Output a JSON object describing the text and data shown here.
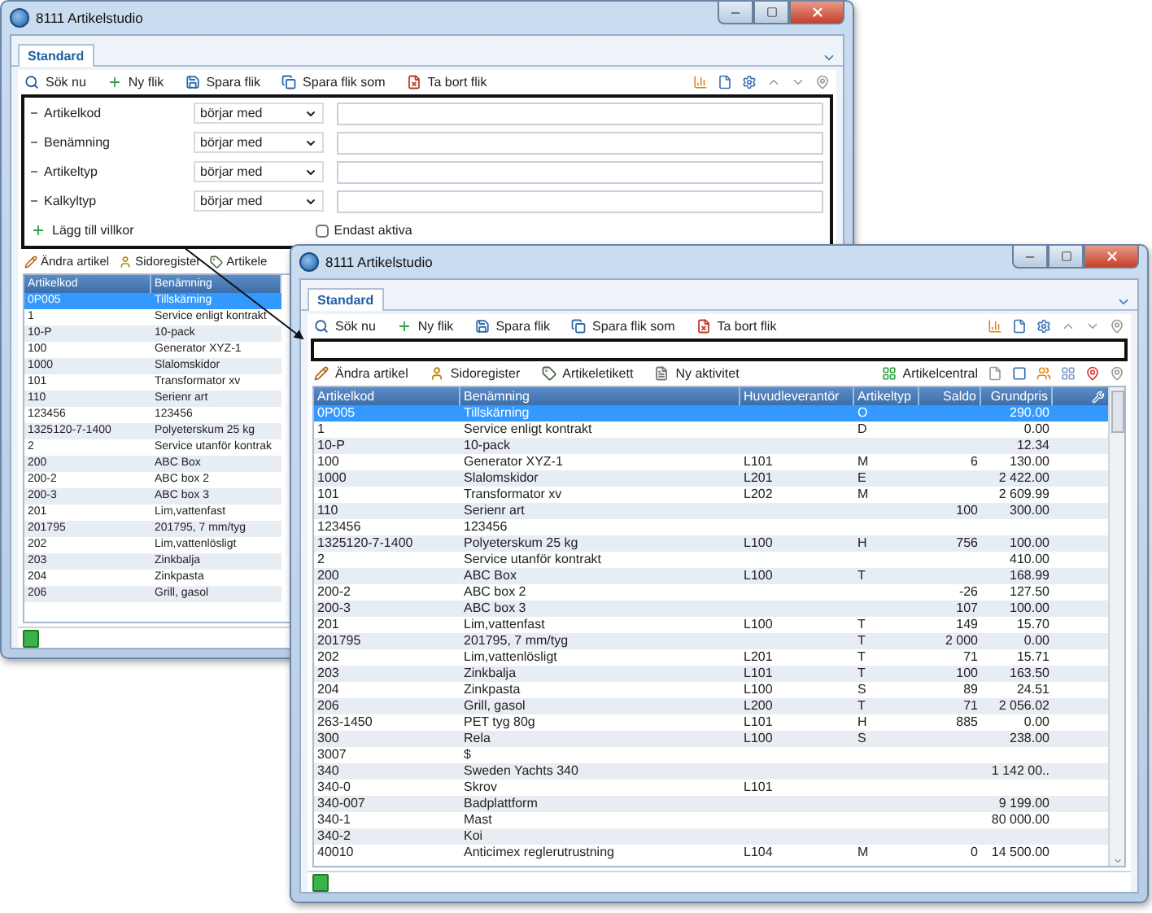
{
  "windows": [
    {
      "title": "8111 Artikelstudio",
      "tabs": [
        {
          "label": "Standard",
          "selected": true
        }
      ],
      "toolbar": [
        {
          "kind": "search",
          "label": "Sök nu"
        },
        {
          "kind": "add",
          "label": "Ny flik"
        },
        {
          "kind": "save",
          "label": "Spara flik"
        },
        {
          "kind": "save_as",
          "label": "Spara flik som"
        },
        {
          "kind": "delete",
          "label": "Ta bort flik"
        }
      ],
      "filter": {
        "conditions": [
          {
            "field": "Artikelkod",
            "operator": "börjar med"
          },
          {
            "field": "Benämning",
            "operator": "börjar med"
          },
          {
            "field": "Artikeltyp",
            "operator": "börjar med"
          },
          {
            "field": "Kalkyltyp",
            "operator": "börjar med"
          }
        ],
        "add_label": "Lägg till villkor",
        "only_active": {
          "label": "Endast aktiva",
          "checked": false
        }
      },
      "actions": [
        {
          "kind": "edit",
          "label": "Ändra artikel"
        },
        {
          "kind": "register",
          "label": "Sidoregister"
        },
        {
          "kind": "label",
          "label": "Artikele"
        }
      ],
      "table": {
        "columns": [
          {
            "label": "Artikelkod",
            "numeric": false
          },
          {
            "label": "Benämning",
            "numeric": false
          }
        ],
        "rows": [
          {
            "cells": [
              "0P005",
              "Tillskärning"
            ],
            "selected": true
          },
          {
            "cells": [
              "1",
              "Service enligt kontrakt"
            ],
            "selected": false
          },
          {
            "cells": [
              "10-P",
              "10-pack"
            ],
            "selected": false
          },
          {
            "cells": [
              "100",
              "Generator XYZ-1"
            ],
            "selected": false
          },
          {
            "cells": [
              "1000",
              "Slalomskidor"
            ],
            "selected": false
          },
          {
            "cells": [
              "101",
              "Transformator xv"
            ],
            "selected": false
          },
          {
            "cells": [
              "110",
              "Serienr art"
            ],
            "selected": false
          },
          {
            "cells": [
              "123456",
              "123456"
            ],
            "selected": false
          },
          {
            "cells": [
              "1325120-7-1400",
              "Polyeterskum 25 kg"
            ],
            "selected": false
          },
          {
            "cells": [
              "2",
              "Service utanför kontrak"
            ],
            "selected": false
          },
          {
            "cells": [
              "200",
              "ABC Box"
            ],
            "selected": false
          },
          {
            "cells": [
              "200-2",
              "ABC box 2"
            ],
            "selected": false
          },
          {
            "cells": [
              "200-3",
              "ABC box 3"
            ],
            "selected": false
          },
          {
            "cells": [
              "201",
              "Lim,vattenfast"
            ],
            "selected": false
          },
          {
            "cells": [
              "201795",
              "201795, 7 mm/tyg"
            ],
            "selected": false
          },
          {
            "cells": [
              "202",
              "Lim,vattenlösligt"
            ],
            "selected": false
          },
          {
            "cells": [
              "203",
              "Zinkbalja"
            ],
            "selected": false
          },
          {
            "cells": [
              "204",
              "Zinkpasta"
            ],
            "selected": false
          },
          {
            "cells": [
              "206",
              "Grill, gasol"
            ],
            "selected": false
          }
        ]
      }
    },
    {
      "title": "8111 Artikelstudio",
      "tabs": [
        {
          "label": "Standard",
          "selected": true
        }
      ],
      "toolbar": [
        {
          "kind": "search",
          "label": "Sök nu"
        },
        {
          "kind": "add",
          "label": "Ny flik"
        },
        {
          "kind": "save",
          "label": "Spara flik"
        },
        {
          "kind": "save_as",
          "label": "Spara flik som"
        },
        {
          "kind": "delete",
          "label": "Ta bort flik"
        }
      ],
      "actions": [
        {
          "kind": "edit",
          "label": "Ändra artikel"
        },
        {
          "kind": "register",
          "label": "Sidoregister"
        },
        {
          "kind": "label",
          "label": "Artikeletikett"
        },
        {
          "kind": "activity",
          "label": "Ny aktivitet"
        }
      ],
      "central": {
        "label": "Artikelcentral"
      },
      "table": {
        "columns": [
          {
            "label": "Artikelkod",
            "numeric": false
          },
          {
            "label": "Benämning",
            "numeric": false
          },
          {
            "label": "Huvudleverantör",
            "numeric": false
          },
          {
            "label": "Artikeltyp",
            "numeric": false
          },
          {
            "label": "Saldo",
            "numeric": true
          },
          {
            "label": "Grundpris",
            "numeric": true
          }
        ],
        "rows": [
          {
            "cells": [
              "0P005",
              "Tillskärning",
              null,
              "O",
              null,
              "290.00"
            ],
            "selected": true
          },
          {
            "cells": [
              "1",
              "Service enligt kontrakt",
              null,
              "D",
              null,
              "0.00"
            ],
            "selected": false
          },
          {
            "cells": [
              "10-P",
              "10-pack",
              null,
              null,
              null,
              "12.34"
            ],
            "selected": false
          },
          {
            "cells": [
              "100",
              "Generator XYZ-1",
              "L101",
              "M",
              "6",
              "130.00"
            ],
            "selected": false
          },
          {
            "cells": [
              "1000",
              "Slalomskidor",
              "L201",
              "E",
              null,
              "2 422.00"
            ],
            "selected": false
          },
          {
            "cells": [
              "101",
              "Transformator xv",
              "L202",
              "M",
              null,
              "2 609.99"
            ],
            "selected": false
          },
          {
            "cells": [
              "110",
              "Serienr art",
              null,
              null,
              "100",
              "300.00"
            ],
            "selected": false
          },
          {
            "cells": [
              "123456",
              "123456",
              null,
              null,
              null,
              null
            ],
            "selected": false
          },
          {
            "cells": [
              "1325120-7-1400",
              "Polyeterskum 25 kg",
              "L100",
              "H",
              "756",
              "100.00"
            ],
            "selected": false
          },
          {
            "cells": [
              "2",
              "Service utanför kontrakt",
              null,
              null,
              null,
              "410.00"
            ],
            "selected": false
          },
          {
            "cells": [
              "200",
              "ABC Box",
              "L100",
              "T",
              null,
              "168.99"
            ],
            "selected": false
          },
          {
            "cells": [
              "200-2",
              "ABC box 2",
              null,
              null,
              "-26",
              "127.50"
            ],
            "selected": false
          },
          {
            "cells": [
              "200-3",
              "ABC box 3",
              null,
              null,
              "107",
              "100.00"
            ],
            "selected": false
          },
          {
            "cells": [
              "201",
              "Lim,vattenfast",
              "L100",
              "T",
              "149",
              "15.70"
            ],
            "selected": false
          },
          {
            "cells": [
              "201795",
              "201795, 7 mm/tyg",
              null,
              "T",
              "2 000",
              "0.00"
            ],
            "selected": false
          },
          {
            "cells": [
              "202",
              "Lim,vattenlösligt",
              "L201",
              "T",
              "71",
              "15.71"
            ],
            "selected": false
          },
          {
            "cells": [
              "203",
              "Zinkbalja",
              "L101",
              "T",
              "100",
              "163.50"
            ],
            "selected": false
          },
          {
            "cells": [
              "204",
              "Zinkpasta",
              "L100",
              "S",
              "89",
              "24.51"
            ],
            "selected": false
          },
          {
            "cells": [
              "206",
              "Grill, gasol",
              "L200",
              "T",
              "71",
              "2 056.02"
            ],
            "selected": false
          },
          {
            "cells": [
              "263-1450",
              "PET tyg 80g",
              "L101",
              "H",
              "885",
              "0.00"
            ],
            "selected": false
          },
          {
            "cells": [
              "300",
              "Rela",
              "L100",
              "S",
              null,
              "238.00"
            ],
            "selected": false
          },
          {
            "cells": [
              "3007",
              "$",
              null,
              null,
              null,
              null
            ],
            "selected": false
          },
          {
            "cells": [
              "340",
              "Sweden Yachts 340",
              null,
              null,
              null,
              "1 142 00.."
            ],
            "selected": false
          },
          {
            "cells": [
              "340-0",
              "Skrov",
              "L101",
              null,
              null,
              null
            ],
            "selected": false
          },
          {
            "cells": [
              "340-007",
              "Badplattform",
              null,
              null,
              null,
              "9 199.00"
            ],
            "selected": false
          },
          {
            "cells": [
              "340-1",
              "Mast",
              null,
              null,
              null,
              "80 000.00"
            ],
            "selected": false
          },
          {
            "cells": [
              "340-2",
              "Koi",
              null,
              null,
              null,
              null
            ],
            "selected": false
          },
          {
            "cells": [
              "40010",
              "Anticimex reglerutrustning",
              "L104",
              "M",
              "0",
              "14 500.00"
            ],
            "selected": false
          }
        ]
      }
    }
  ]
}
